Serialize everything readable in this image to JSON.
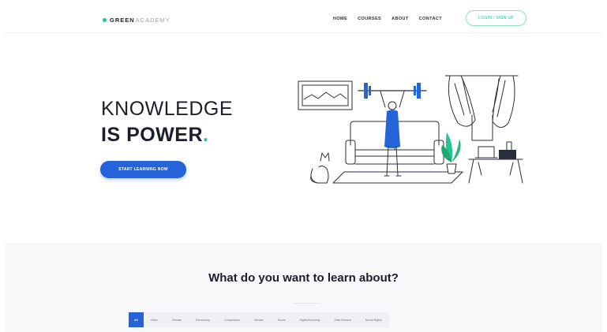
{
  "nav": {
    "brand_bold": "GREEN",
    "brand_light": "ACADEMY",
    "links": [
      "HOME",
      "COURSES",
      "ABOUT",
      "CONTACT"
    ],
    "signin_label": "LOGIN / SIGN UP"
  },
  "hero": {
    "title_line1": "KNOWLEDGE",
    "title_line2": "IS POWER",
    "title_accent": ".",
    "cta_label": "START LEARNING NOW"
  },
  "section": {
    "title": "What do you want to learn about?"
  },
  "filters": [
    "All",
    "Video",
    "Climate",
    "Democracy",
    "Cooperation",
    "Gender",
    "Social",
    "Digital Economy",
    "Data Science",
    "Social Rights"
  ],
  "colors": {
    "accent": "#23c48e",
    "primary": "#2563d8",
    "text": "#1c1e2b"
  }
}
